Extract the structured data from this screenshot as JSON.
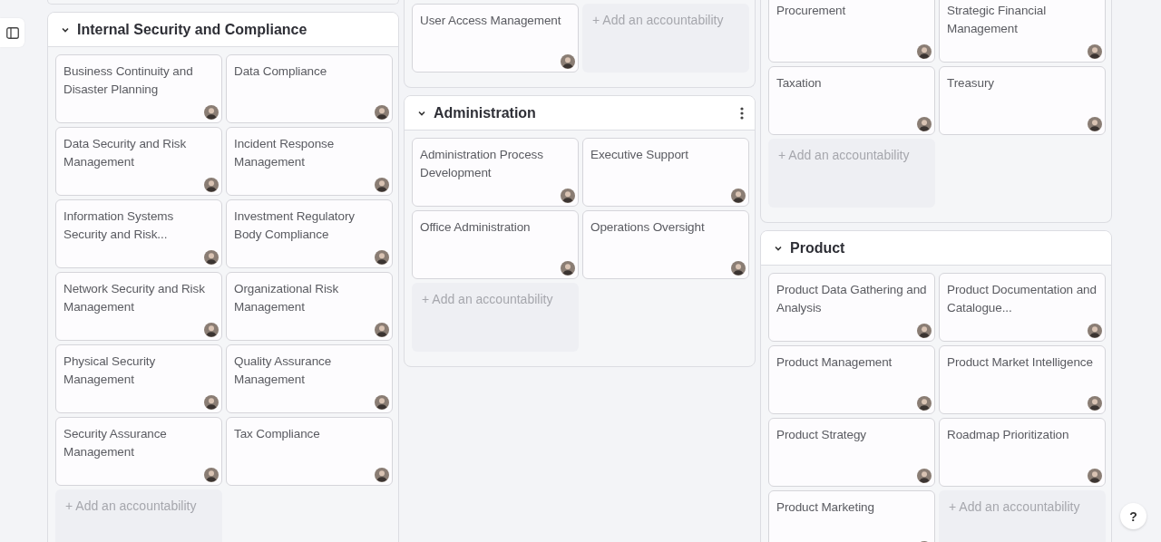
{
  "columns": [
    {
      "sections": [
        {
          "title": "Internal Security and Compliance",
          "expanded": true,
          "menu_button": false,
          "items": [
            {
              "label": "Business Continuity and Disaster Planning"
            },
            {
              "label": "Data Compliance"
            },
            {
              "label": "Data Security and Risk Management"
            },
            {
              "label": "Incident Response Management"
            },
            {
              "label": "Information Systems Security and Risk..."
            },
            {
              "label": "Investment Regulatory Body Compliance"
            },
            {
              "label": "Network Security and Risk Management"
            },
            {
              "label": "Organizational Risk Management"
            },
            {
              "label": "Physical Security Management"
            },
            {
              "label": "Quality Assurance Management"
            },
            {
              "label": "Security Assurance Management"
            },
            {
              "label": "Tax Compliance"
            }
          ],
          "add_label": "+ Add an accountability"
        }
      ]
    },
    {
      "sections": [
        {
          "items": [
            {
              "label": "User Access Management"
            }
          ],
          "add_label": "+ Add an accountability"
        },
        {
          "title": "Administration",
          "expanded": true,
          "menu_button": true,
          "items": [
            {
              "label": "Administration Process Development"
            },
            {
              "label": "Executive Support"
            },
            {
              "label": "Office Administration"
            },
            {
              "label": "Operations Oversight"
            }
          ],
          "add_label": "+ Add an accountability"
        }
      ]
    },
    {
      "sections": [
        {
          "items": [
            {
              "label": "Procurement"
            },
            {
              "label": "Strategic Financial Management"
            },
            {
              "label": "Taxation"
            },
            {
              "label": "Treasury"
            }
          ],
          "add_label": "+ Add an accountability"
        },
        {
          "title": "Product",
          "expanded": true,
          "menu_button": false,
          "items": [
            {
              "label": "Product Data Gathering and Analysis"
            },
            {
              "label": "Product Documentation and Catalogue..."
            },
            {
              "label": "Product Management"
            },
            {
              "label": "Product Market Intelligence"
            },
            {
              "label": "Product Strategy"
            },
            {
              "label": "Roadmap Prioritization"
            },
            {
              "label": "Product Marketing"
            }
          ],
          "add_label": "+ Add an accountability"
        }
      ]
    }
  ],
  "help_button": {
    "label": "?"
  }
}
